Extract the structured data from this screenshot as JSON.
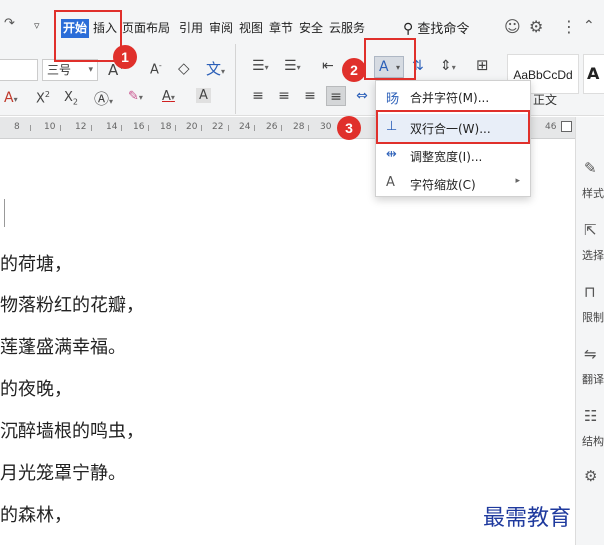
{
  "menubar": {
    "tabs": [
      {
        "label": "开始",
        "active": true
      },
      {
        "label": "插入"
      },
      {
        "label": "页面布局"
      },
      {
        "label": "引用"
      },
      {
        "label": "审阅"
      },
      {
        "label": "视图"
      },
      {
        "label": "章节"
      },
      {
        "label": "安全"
      },
      {
        "label": "云服务"
      }
    ],
    "search_label": "查找命令"
  },
  "ribbon": {
    "font_size_value": "三号",
    "text_effect_label": "A",
    "style_preview": "AaBbCcDd",
    "style_preview_2": "A",
    "style_name": "正文"
  },
  "ruler": {
    "numbers": [
      "8",
      "10",
      "12",
      "14",
      "16",
      "18",
      "20",
      "22",
      "24",
      "26",
      "28",
      "30"
    ],
    "right_number": "46"
  },
  "document": {
    "lines": [
      "的荷塘，",
      "物落粉红的花瓣，",
      "莲蓬盛满幸福。",
      "的夜晚，",
      "沉醉墙根的鸣虫，",
      "月光笼罩宁静。",
      "的森林，"
    ]
  },
  "dropdown": {
    "items": [
      {
        "icon": "merge-chars-icon",
        "label": "合并字符(M)..."
      },
      {
        "icon": "two-lines-in-one-icon",
        "label": "双行合一(W)..."
      },
      {
        "icon": "adjust-width-icon",
        "label": "调整宽度(I)..."
      },
      {
        "icon": "char-scale-icon",
        "label": "字符缩放(C)"
      }
    ]
  },
  "sidebar": {
    "items": [
      {
        "icon": "pen-icon",
        "label": "样式"
      },
      {
        "icon": "cursor-icon",
        "label": "选择"
      },
      {
        "icon": "lock-icon",
        "label": "限制"
      },
      {
        "icon": "translate-icon",
        "label": "翻译"
      },
      {
        "icon": "structure-icon",
        "label": "结构"
      },
      {
        "icon": "settings-icon",
        "label": ""
      }
    ]
  },
  "annotations": {
    "badges": [
      "1",
      "2",
      "3"
    ]
  },
  "colors": {
    "accent": "#2b6dd8",
    "highlight": "#e0302b",
    "watermark": "#1f3a9e"
  },
  "watermark": "最需教育"
}
